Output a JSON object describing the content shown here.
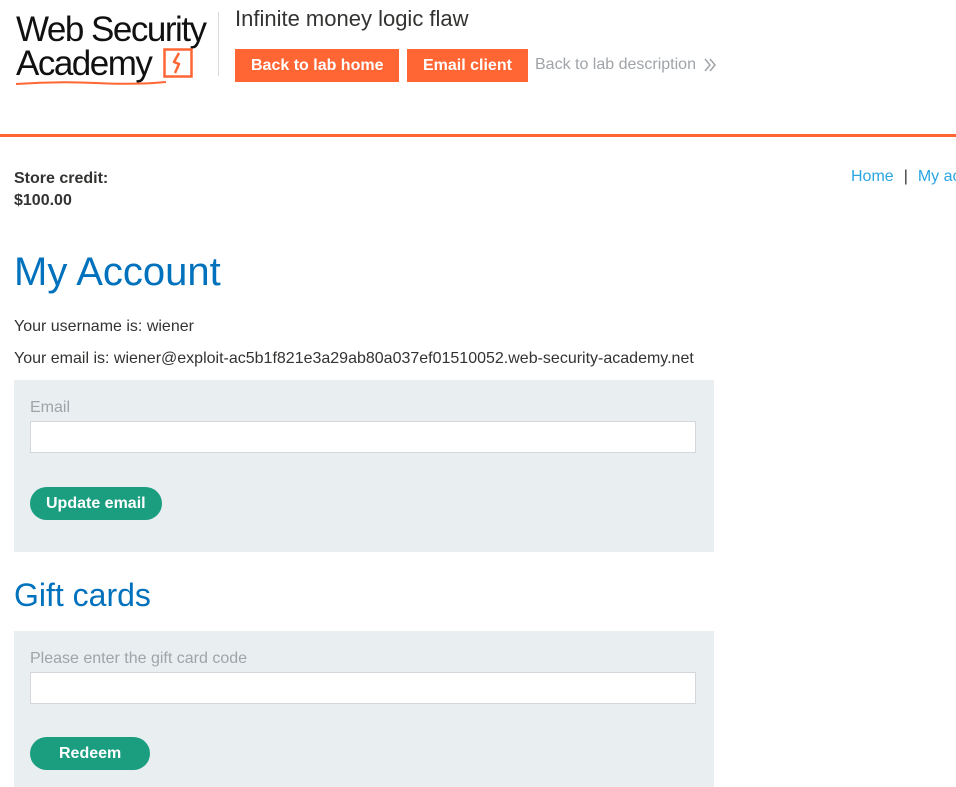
{
  "logo": {
    "line1": "Web Security",
    "line2": "Academy"
  },
  "header": {
    "lab_title": "Infinite money logic flaw",
    "back_to_lab_home": "Back to lab home",
    "email_client": "Email client",
    "back_to_description": "Back to lab description"
  },
  "store": {
    "credit_label": "Store credit:",
    "credit_value": "$100.00"
  },
  "nav": {
    "home": "Home",
    "separator": "|",
    "my_account": "My account"
  },
  "account": {
    "heading": "My Account",
    "username_line": "Your username is: wiener",
    "email_line": "Your email is: wiener@exploit-ac5b1f821e3a29ab80a037ef01510052.web-security-academy.net",
    "email_label": "Email",
    "email_value": "",
    "update_button": "Update email"
  },
  "gift": {
    "heading": "Gift cards",
    "code_label": "Please enter the gift card code",
    "code_value": "",
    "redeem_button": "Redeem"
  },
  "colors": {
    "accent": "#ff6633",
    "heading": "#0071bc",
    "link": "#29a5e0",
    "button": "#1a9e7f",
    "panel": "#e9eef1"
  }
}
